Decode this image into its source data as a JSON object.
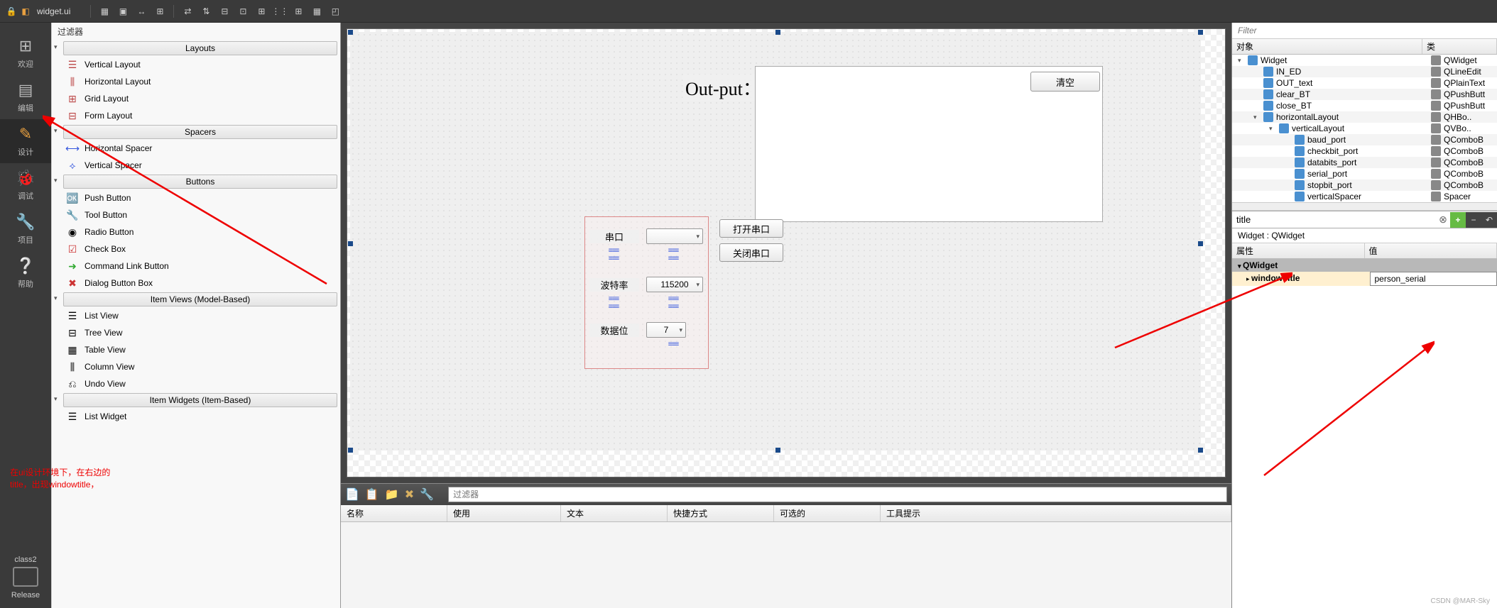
{
  "topbar": {
    "filename": "widget.ui"
  },
  "leftRail": {
    "welcome": "欢迎",
    "edit": "编辑",
    "design": "设计",
    "debug": "调试",
    "project": "项目",
    "help": "帮助",
    "projectName": "class2",
    "release": "Release"
  },
  "widgetBox": {
    "filterLabel": "过滤器",
    "groups": {
      "layouts": "Layouts",
      "spacers": "Spacers",
      "buttons": "Buttons",
      "itemViews": "Item Views (Model-Based)",
      "itemWidgets": "Item Widgets (Item-Based)"
    },
    "items": {
      "verticalLayout": "Vertical Layout",
      "horizontalLayout": "Horizontal Layout",
      "gridLayout": "Grid Layout",
      "formLayout": "Form Layout",
      "horizontalSpacer": "Horizontal Spacer",
      "verticalSpacer": "Vertical Spacer",
      "pushButton": "Push Button",
      "toolButton": "Tool Button",
      "radioButton": "Radio Button",
      "checkBox": "Check Box",
      "commandLinkButton": "Command Link Button",
      "dialogButtonBox": "Dialog Button Box",
      "listView": "List View",
      "treeView": "Tree View",
      "tableView": "Table View",
      "columnView": "Column View",
      "undoView": "Undo View",
      "listWidget": "List Widget"
    }
  },
  "formPreview": {
    "outputLabel": "Out-put：",
    "clearBtn": "清空",
    "openSerialBtn": "打开串口",
    "closeSerialBtn": "关闭串口",
    "labels": {
      "serial": "串口",
      "baud": "波特率",
      "databits": "数据位"
    },
    "values": {
      "serial": "",
      "baud": "115200",
      "databits": "7"
    }
  },
  "bottomPanel": {
    "filterPlaceholder": "过滤器",
    "columns": {
      "name": "名称",
      "used": "使用",
      "text": "文本",
      "shortcut": "快捷方式",
      "checkable": "可选的",
      "tooltip": "工具提示"
    }
  },
  "objectInspector": {
    "filterPlaceholder": "Filter",
    "headers": {
      "object": "对象",
      "class": "类"
    },
    "tree": [
      {
        "name": "Widget",
        "cls": "QWidget",
        "indent": 0,
        "toggle": "▾"
      },
      {
        "name": "IN_ED",
        "cls": "QLineEdit",
        "indent": 1
      },
      {
        "name": "OUT_text",
        "cls": "QPlainText",
        "indent": 1
      },
      {
        "name": "clear_BT",
        "cls": "QPushButt",
        "indent": 1
      },
      {
        "name": "close_BT",
        "cls": "QPushButt",
        "indent": 1
      },
      {
        "name": "horizontalLayout",
        "cls": "QHBo..",
        "indent": 1,
        "toggle": "▾"
      },
      {
        "name": "verticalLayout",
        "cls": "QVBo..",
        "indent": 2,
        "toggle": "▾"
      },
      {
        "name": "baud_port",
        "cls": "QComboB",
        "indent": 3
      },
      {
        "name": "checkbit_port",
        "cls": "QComboB",
        "indent": 3
      },
      {
        "name": "databits_port",
        "cls": "QComboB",
        "indent": 3
      },
      {
        "name": "serial_port",
        "cls": "QComboB",
        "indent": 3
      },
      {
        "name": "stopbit_port",
        "cls": "QComboB",
        "indent": 3
      },
      {
        "name": "verticalSpacer",
        "cls": "Spacer",
        "indent": 3
      }
    ]
  },
  "propertyEditor": {
    "filterValue": "title",
    "widgetPath": "Widget : QWidget",
    "headers": {
      "prop": "属性",
      "val": "值"
    },
    "groupName": "QWidget",
    "propName": "windowTitle",
    "propValue": "person_serial"
  },
  "annotation": {
    "line1": "在ui设计环境下，在右边的",
    "line2": "title，出现windowtitle，"
  },
  "watermark": "CSDN @MAR-Sky"
}
